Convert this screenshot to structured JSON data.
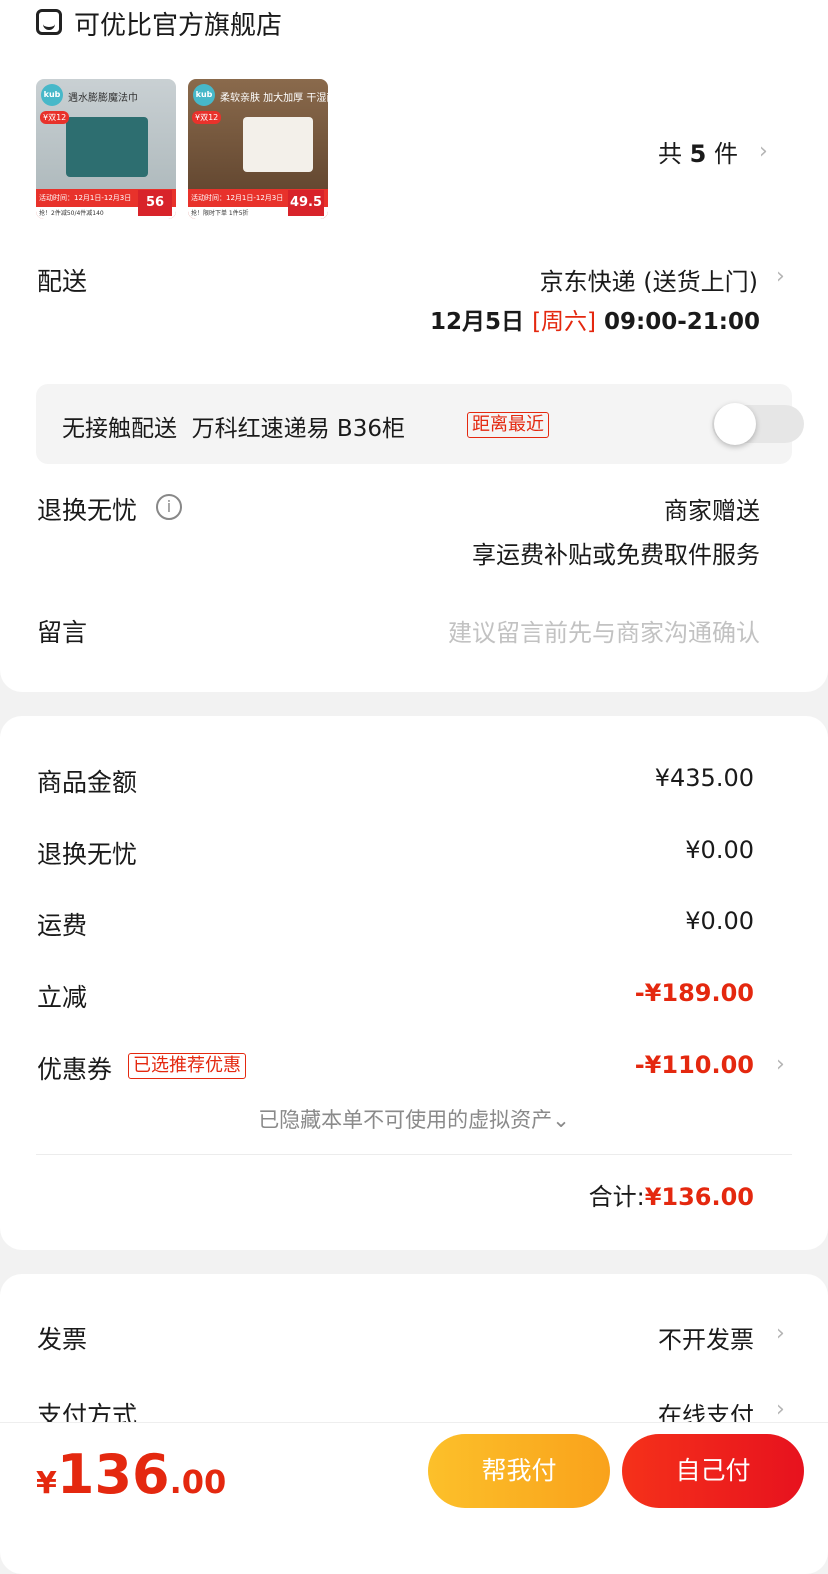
{
  "store": {
    "name": "可优比官方旗舰店",
    "icon": "store-icon"
  },
  "products": {
    "items": [
      {
        "brand": "kub",
        "title": "遇水膨膨魔法巾",
        "price": "56",
        "activity": "活动时间：12月1日-12月3日",
        "promo": "抢！2件减50/4件减140",
        "badge": "¥双12"
      },
      {
        "brand": "kub",
        "title": "柔软亲肤 加大加厚 干湿两用",
        "price": "49.5",
        "activity": "活动时间：12月1日-12月3日",
        "promo": "抢！限时下单 1件5折",
        "badge": "¥双12"
      }
    ],
    "count_prefix": "共",
    "count": "5",
    "count_suffix": "件"
  },
  "delivery": {
    "label": "配送",
    "method": "京东快递 (送货上门)",
    "date": "12月5日",
    "weekday": "[周六]",
    "time": "09:00-21:00"
  },
  "contactless": {
    "label": "无接触配送",
    "location": "万科红速递易 B36柜",
    "tag": "距离最近",
    "enabled": false
  },
  "return_worry": {
    "label": "退换无忧",
    "line1": "商家赠送",
    "line2": "享运费补贴或免费取件服务"
  },
  "message": {
    "label": "留言",
    "placeholder": "建议留言前先与商家沟通确认"
  },
  "summary": {
    "goods_label": "商品金额",
    "goods_value": "¥435.00",
    "return_label": "退换无忧",
    "return_value": "¥0.00",
    "shipping_label": "运费",
    "shipping_value": "¥0.00",
    "discount_label": "立减",
    "discount_value": "-¥189.00",
    "coupon_label": "优惠券",
    "coupon_tag": "已选推荐优惠",
    "coupon_value": "-¥110.00",
    "hidden_note": "已隐藏本单不可使用的虚拟资产",
    "total_label": "合计:",
    "total_value": "¥136.00"
  },
  "invoice": {
    "label": "发票",
    "value": "不开发票"
  },
  "payment": {
    "label": "支付方式",
    "value": "在线支付"
  },
  "footer": {
    "currency": "¥",
    "price_int": "136",
    "price_dec": ".00",
    "help_pay": "帮我付",
    "self_pay": "自己付"
  },
  "colors": {
    "accent_red": "#e4280f",
    "help_btn": "#fbb324",
    "self_btn": "#f0201c"
  }
}
